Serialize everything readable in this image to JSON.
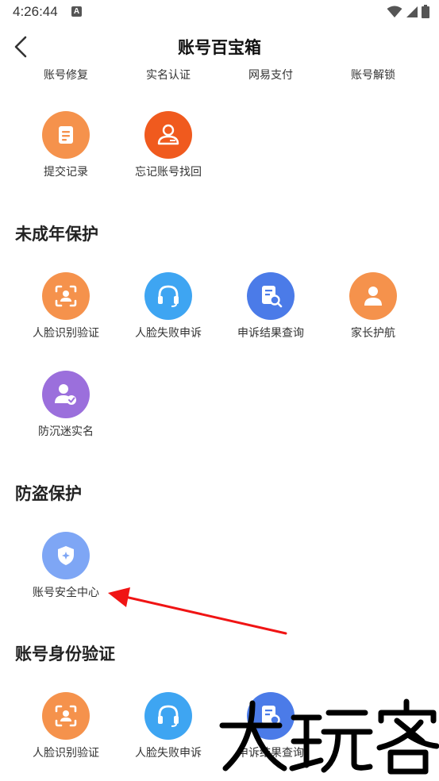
{
  "status_bar": {
    "time": "4:26:44",
    "app_icon_letter": "A"
  },
  "header": {
    "title": "账号百宝箱"
  },
  "top_row": {
    "items": [
      "账号修复",
      "实名认证",
      "网易支付",
      "账号解锁"
    ]
  },
  "account_section": {
    "items": [
      {
        "label": "提交记录",
        "icon": "document-icon",
        "color": "#F5924C"
      },
      {
        "label": "忘记账号找回",
        "icon": "user-card-icon",
        "color": "#F05A1E"
      }
    ]
  },
  "minor_section": {
    "title": "未成年保护",
    "items": [
      {
        "label": "人脸识别验证",
        "icon": "face-scan-icon",
        "color": "#F5924C"
      },
      {
        "label": "人脸失败申诉",
        "icon": "headset-icon",
        "color": "#3EA5F2"
      },
      {
        "label": "申诉结果查询",
        "icon": "document-search-icon",
        "color": "#4B7BE8"
      },
      {
        "label": "家长护航",
        "icon": "person-icon",
        "color": "#F5924C"
      },
      {
        "label": "防沉迷实名",
        "icon": "user-verified-icon",
        "color": "#9B6FDC"
      }
    ]
  },
  "theft_section": {
    "title": "防盗保护",
    "items": [
      {
        "label": "账号安全中心",
        "icon": "shield-icon",
        "color": "#7EA6F5"
      }
    ]
  },
  "identity_section": {
    "title": "账号身份验证",
    "items": [
      {
        "label": "人脸识别验证",
        "icon": "face-scan-icon",
        "color": "#F5924C"
      },
      {
        "label": "人脸失败申诉",
        "icon": "headset-icon",
        "color": "#3EA5F2"
      },
      {
        "label": "申诉结果查询",
        "icon": "document-search-icon",
        "color": "#4B7BE8"
      }
    ]
  },
  "annotation": {
    "arrow_color": "#F01414"
  },
  "watermark": {
    "text": "大玩客"
  }
}
